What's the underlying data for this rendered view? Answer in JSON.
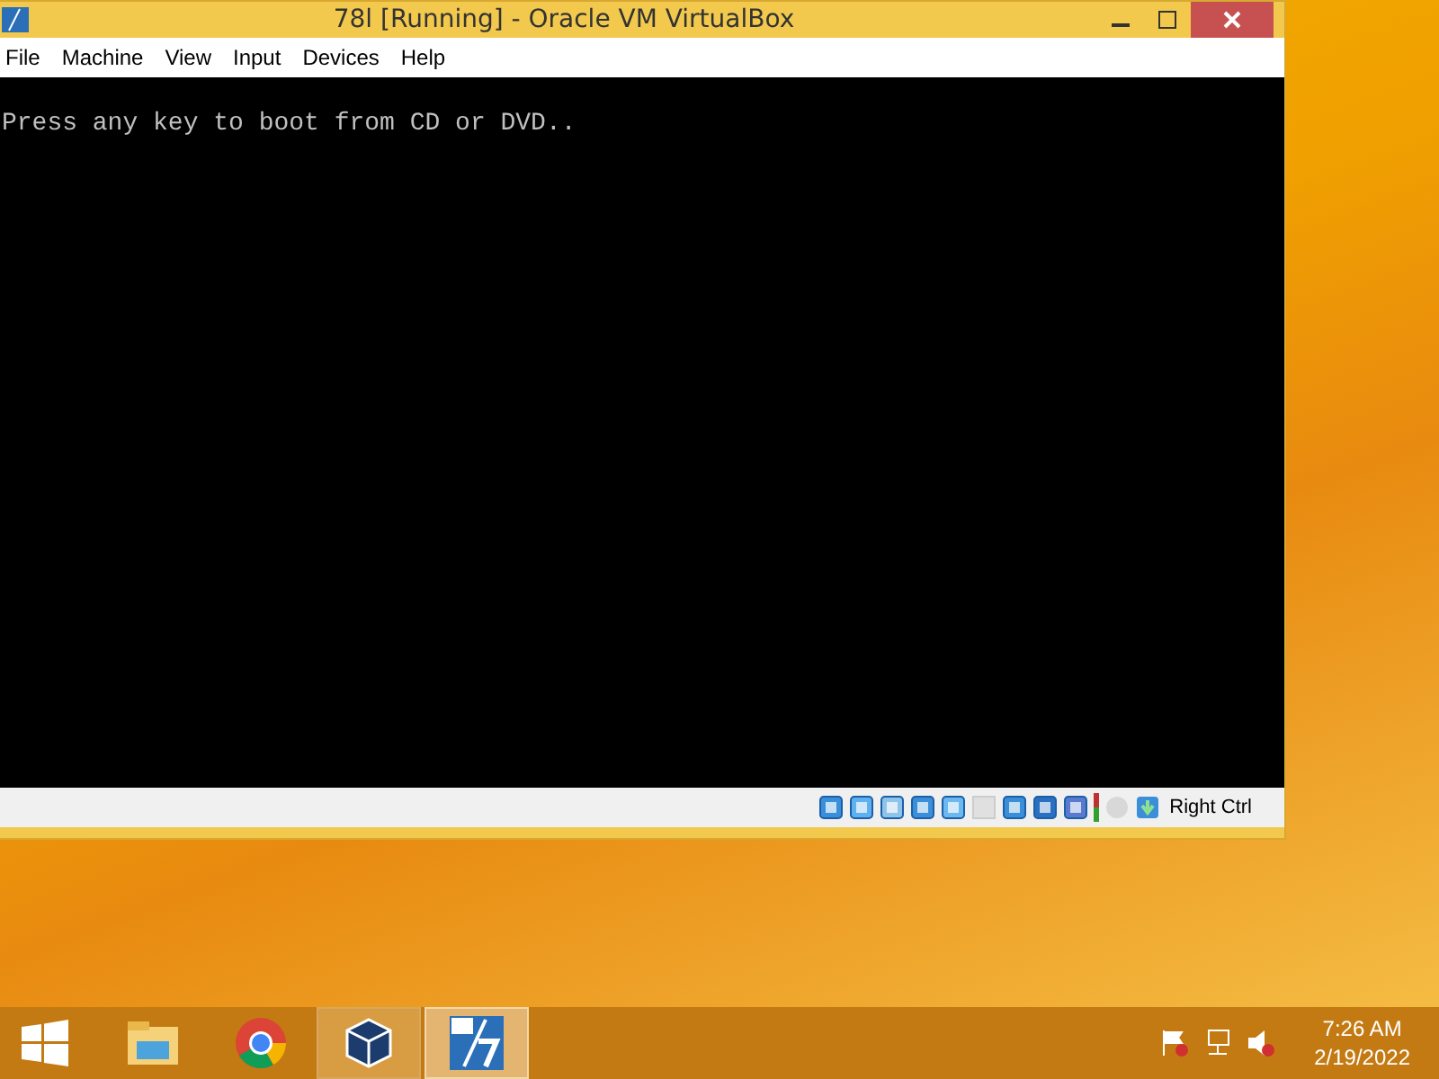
{
  "window": {
    "title": "78l [Running] - Oracle VM VirtualBox"
  },
  "menu": [
    "File",
    "Machine",
    "View",
    "Input",
    "Devices",
    "Help"
  ],
  "console": {
    "text": "Press any key to boot from CD or DVD.."
  },
  "status_bar": {
    "host_key": "Right Ctrl"
  },
  "taskbar": {
    "apps": [
      {
        "kind": "explorer",
        "running": false,
        "selected": false
      },
      {
        "kind": "chrome",
        "running": false,
        "selected": false
      },
      {
        "kind": "virtualbox",
        "running": true,
        "selected": false
      },
      {
        "kind": "vm",
        "running": true,
        "selected": true
      }
    ],
    "time": "7:26 AM",
    "date": "2/19/2022"
  }
}
